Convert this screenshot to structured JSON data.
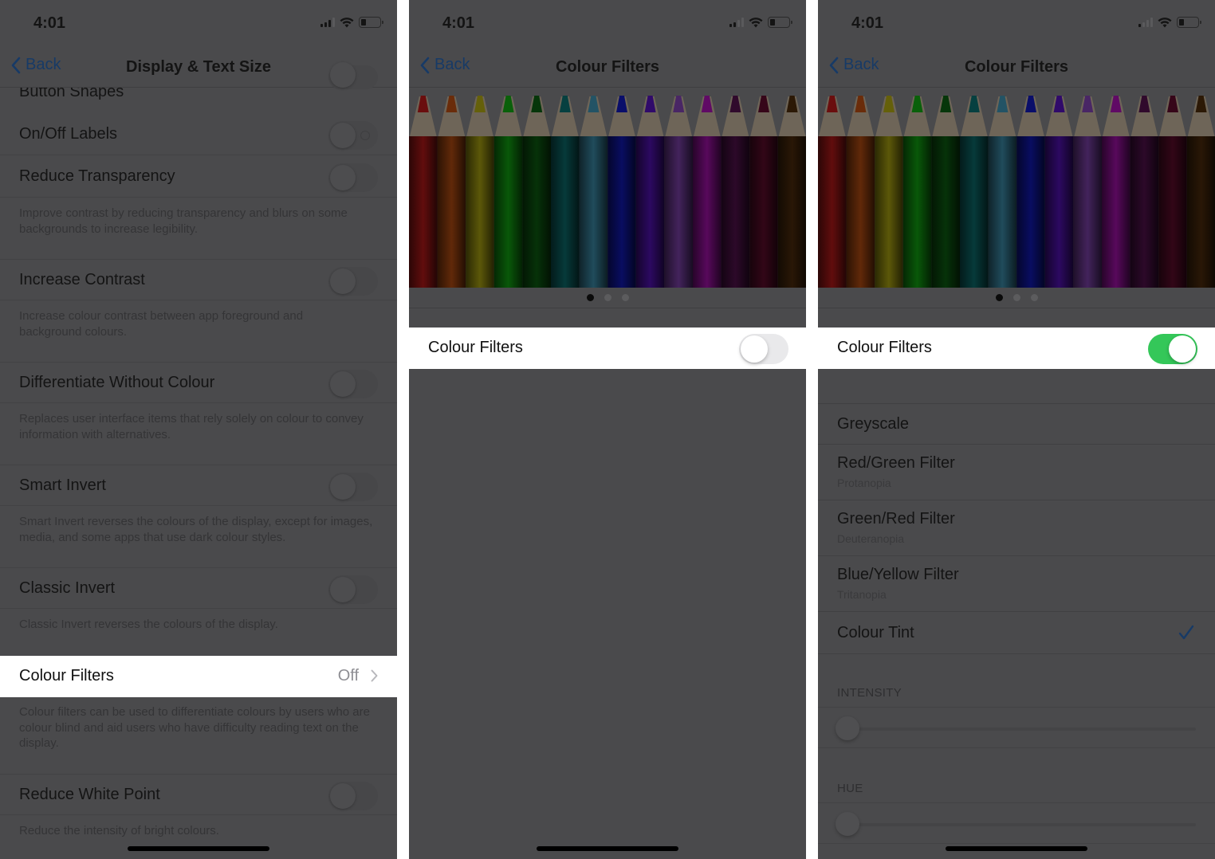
{
  "colors": {
    "dim_bg": "#4a4a4c",
    "highlight_bg": "#ffffff",
    "toggle_on": "#34c759",
    "accent_dimmed": "#173a66",
    "secondary_text": "#8e8e93"
  },
  "panels": [
    {
      "status": {
        "time": "4:01"
      },
      "nav": {
        "back_label": "Back",
        "title": "Display & Text Size"
      },
      "rows": [
        {
          "label": "Button Shapes",
          "toggle": false
        },
        {
          "label": "On/Off Labels",
          "toggle": false
        },
        {
          "label": "Reduce Transparency",
          "toggle": false,
          "footer": "Improve contrast by reducing transparency and blurs on some backgrounds to increase legibility."
        },
        {
          "label": "Increase Contrast",
          "toggle": false,
          "footer": "Increase colour contrast between app foreground and background colours."
        },
        {
          "label": "Differentiate Without Colour",
          "toggle": false,
          "footer": "Replaces user interface items that rely solely on colour to convey information with alternatives."
        },
        {
          "label": "Smart Invert",
          "toggle": false,
          "footer": "Smart Invert reverses the colours of the display, except for images, media, and some apps that use dark colour styles."
        },
        {
          "label": "Classic Invert",
          "toggle": false,
          "footer": "Classic Invert reverses the colours of the display."
        },
        {
          "label": "Colour Filters",
          "value": "Off",
          "highlighted": true,
          "footer": "Colour filters can be used to differentiate colours by users who are colour blind and aid users who have difficulty reading text on the display."
        },
        {
          "label": "Reduce White Point",
          "toggle": false,
          "footer": "Reduce the intensity of bright colours."
        }
      ]
    },
    {
      "status": {
        "time": "4:01"
      },
      "nav": {
        "back_label": "Back",
        "title": "Colour Filters"
      },
      "carousel": {
        "pages": 3,
        "current_page": 1
      },
      "colour_filters_row": {
        "label": "Colour Filters",
        "enabled": false
      }
    },
    {
      "status": {
        "time": "4:01"
      },
      "nav": {
        "back_label": "Back",
        "title": "Colour Filters"
      },
      "carousel": {
        "pages": 3,
        "current_page": 1
      },
      "colour_filters_row": {
        "label": "Colour Filters",
        "enabled": true
      },
      "filter_options": [
        {
          "label": "Greyscale",
          "sub": "",
          "selected": false
        },
        {
          "label": "Red/Green Filter",
          "sub": "Protanopia",
          "selected": false
        },
        {
          "label": "Green/Red Filter",
          "sub": "Deuteranopia",
          "selected": false
        },
        {
          "label": "Blue/Yellow Filter",
          "sub": "Tritanopia",
          "selected": false
        },
        {
          "label": "Colour Tint",
          "sub": "",
          "selected": true
        }
      ],
      "intensity": {
        "header": "INTENSITY",
        "value": 0
      },
      "hue": {
        "header": "HUE",
        "value": 0
      }
    }
  ],
  "pencil_colors": [
    "#b01818",
    "#b04a10",
    "#a8a010",
    "#10a010",
    "#0a5a10",
    "#0a6a6a",
    "#3a8aa8",
    "#1018b0",
    "#5010b0",
    "#7a40a8",
    "#a010a8",
    "#50104a",
    "#5a0a2a",
    "#4a2a0a"
  ]
}
